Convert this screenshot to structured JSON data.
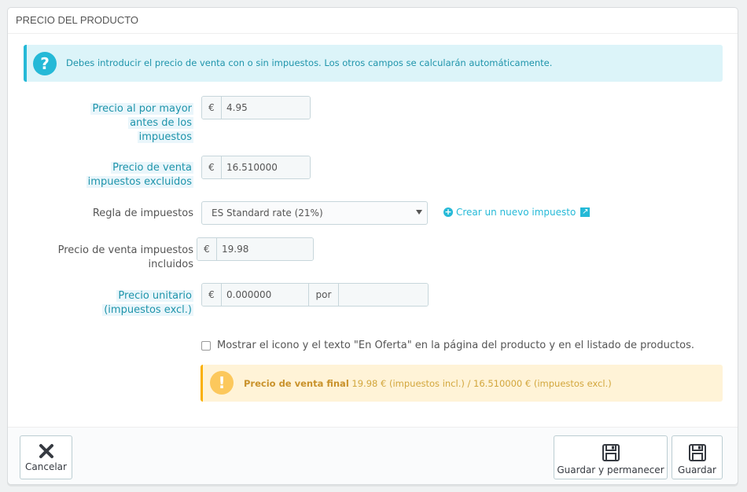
{
  "panel": {
    "title": "PRECIO DEL PRODUCTO"
  },
  "info": {
    "text": "Debes introducir el precio de venta con o sin impuestos. Los otros campos se calcularán automáticamente."
  },
  "fields": {
    "wholesale": {
      "label_lines": [
        "Precio al por mayor",
        "antes de los",
        "impuestos"
      ],
      "currency": "€",
      "value": "4.95"
    },
    "retail_excl": {
      "label_lines": [
        "Precio de venta",
        "impuestos excluidos"
      ],
      "currency": "€",
      "value": "16.510000"
    },
    "tax_rule": {
      "label": "Regla de impuestos",
      "selected": "ES Standard rate (21%)",
      "create_link": "Crear un nuevo impuesto"
    },
    "retail_incl": {
      "label_lines": [
        "Precio de venta impuestos",
        "incluidos"
      ],
      "currency": "€",
      "value": "19.98"
    },
    "unit_price": {
      "label_lines": [
        "Precio unitario",
        "(impuestos excl.)"
      ],
      "currency": "€",
      "value": "0.000000",
      "per_label": "por",
      "unit_value": ""
    }
  },
  "on_sale": {
    "label": "Mostrar el icono y el texto \"En Oferta\" en la página del producto y en el listado de productos.",
    "checked": false
  },
  "final_price": {
    "heading": "Precio de venta final",
    "text": " 19.98 € (impuestos incl.) / 16.510000 € (impuestos excl.)"
  },
  "footer": {
    "cancel_label": "Cancelar",
    "save_stay_label": "Guardar y permanecer",
    "save_label": "Guardar"
  },
  "icons": {
    "info": "question-icon",
    "warning": "exclamation-icon",
    "cancel": "close-icon",
    "save": "floppy-disk-icon",
    "add": "plus-circle-icon",
    "external": "external-link-icon"
  },
  "colors": {
    "accent": "#25b9d7",
    "warning": "#fab000",
    "warning_bg": "#fff3d7",
    "info_bg": "#dcf4f9"
  }
}
